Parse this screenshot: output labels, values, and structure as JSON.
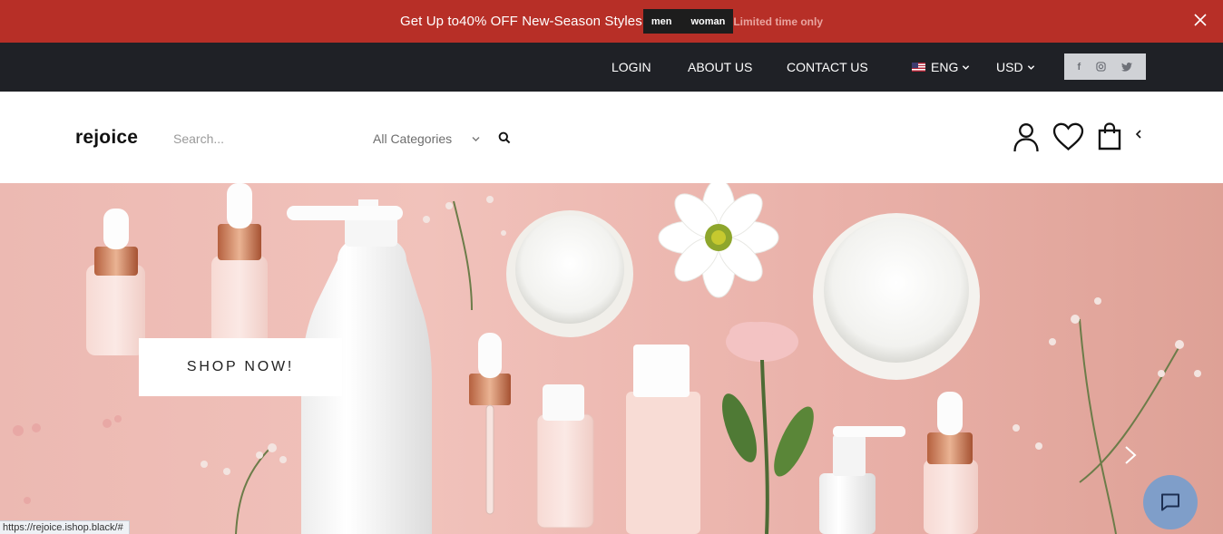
{
  "promo": {
    "text": "Get Up to40% OFF New-Season Styles",
    "tags": [
      "men",
      "woman"
    ],
    "limited": "Limited time only"
  },
  "topnav": {
    "links": [
      "LOGIN",
      "ABOUT US",
      "CONTACT US"
    ],
    "language": "ENG",
    "currency": "USD",
    "social": [
      "facebook-icon",
      "instagram-icon",
      "twitter-icon"
    ]
  },
  "header": {
    "logo": "rejoice",
    "search_placeholder": "Search...",
    "category": "All Categories",
    "icons": [
      "user-icon",
      "heart-icon",
      "bag-icon",
      "chevron-left-icon"
    ]
  },
  "hero": {
    "cta": "SHOP NOW!",
    "image_subject": "skincare bottles, cream jars and flowers on pink background"
  },
  "status_bar": {
    "url": "https://rejoice.ishop.black/#"
  },
  "colors": {
    "promo_bg": "#b72f27",
    "topbar_bg": "#1f2126",
    "hero_bg": "#ecb9b2",
    "chat_bg": "#7f9ec9"
  }
}
